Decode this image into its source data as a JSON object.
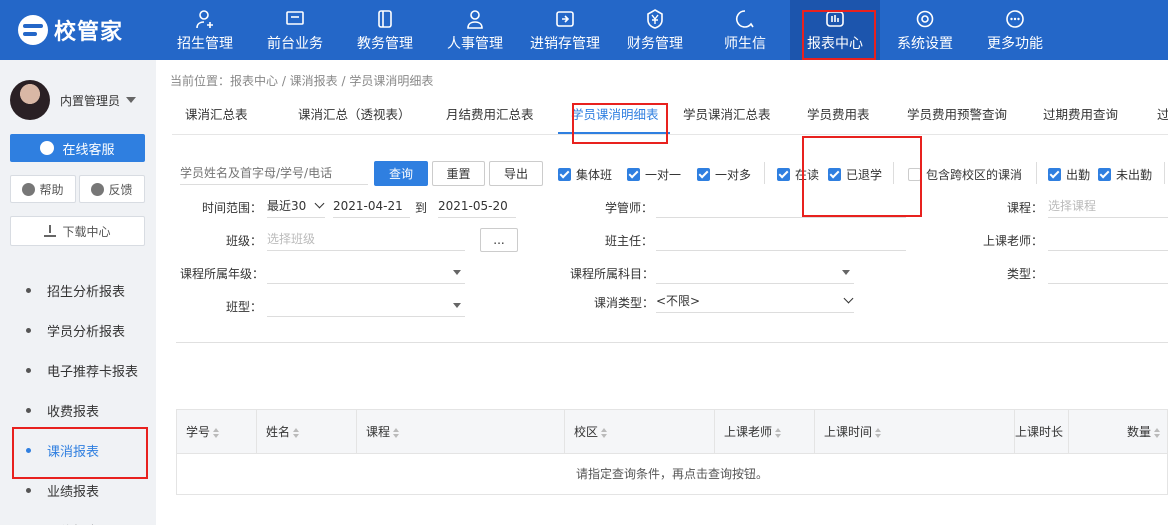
{
  "brand": {
    "name": "校管家",
    "bg_color": "#2467c8"
  },
  "nav": [
    {
      "label": "招生管理",
      "icon": "person-add-icon"
    },
    {
      "label": "前台业务",
      "icon": "monitor-icon"
    },
    {
      "label": "教务管理",
      "icon": "book-icon"
    },
    {
      "label": "人事管理",
      "icon": "person-icon"
    },
    {
      "label": "进销存管理",
      "icon": "inventory-icon"
    },
    {
      "label": "财务管理",
      "icon": "yen-icon"
    },
    {
      "label": "师生信",
      "icon": "chat-icon"
    },
    {
      "label": "报表中心",
      "icon": "report-icon",
      "active": true
    },
    {
      "label": "系统设置",
      "icon": "gear-icon"
    },
    {
      "label": "更多功能",
      "icon": "more-icon"
    }
  ],
  "sidebar": {
    "user_name": "内置管理员",
    "service_button": "在线客服",
    "help_button": "帮助",
    "feedback_button": "反馈",
    "download_button": "下载中心",
    "menu": [
      "招生分析报表",
      "学员分析报表",
      "电子推荐卡报表",
      "收费报表",
      "课消报表",
      "业绩报表",
      "预约报表"
    ],
    "active_menu": "课消报表"
  },
  "breadcrumb": "当前位置：报表中心 / 课消报表 / 学员课消明细表",
  "tabs": [
    "课消汇总表",
    "课消汇总（透视表）",
    "月结费用汇总表",
    "学员课消明细表",
    "学员课消汇总表",
    "学员费用表",
    "学员费用预警查询",
    "过期费用查询",
    "过期"
  ],
  "active_tab": "学员课消明细表",
  "search": {
    "placeholder": "学员姓名及首字母/学号/电话",
    "query_button": "查询",
    "reset_button": "重置",
    "export_button": "导出"
  },
  "filters_checks": [
    {
      "label": "集体班",
      "checked": true
    },
    {
      "label": "一对一",
      "checked": true
    },
    {
      "label": "一对多",
      "checked": true
    },
    {
      "label": "在读",
      "checked": true
    },
    {
      "label": "已退学",
      "checked": true
    },
    {
      "label": "包含跨校区的课消",
      "checked": false
    },
    {
      "label": "出勤",
      "checked": true
    },
    {
      "label": "未出勤",
      "checked": true
    }
  ],
  "form": {
    "time_range_label": "时间范围：",
    "time_range_select": "最近30",
    "date_from": "2021-04-21",
    "date_to_label": "到",
    "date_to": "2021-05-20",
    "study_manager_label": "学管师：",
    "course_label": "课程：",
    "course_placeholder": "选择课程",
    "class_label": "班级：",
    "class_placeholder": "选择班级",
    "class_pick_button": "...",
    "head_teacher_label": "班主任：",
    "teacher_label": "上课老师：",
    "grade_label": "课程所属年级：",
    "subject_label": "课程所属科目：",
    "type_label": "类型：",
    "class_type_label": "班型：",
    "consume_type_label": "课消类型：",
    "consume_type_value": "<不限>"
  },
  "table": {
    "columns": [
      "学号",
      "姓名",
      "课程",
      "校区",
      "上课老师",
      "上课时间",
      "上课时长",
      "数量"
    ],
    "empty_message": "请指定查询条件，再点击查询按钮。"
  },
  "colors": {
    "accent": "#2f7fe0",
    "highlight": "#e8211e"
  }
}
